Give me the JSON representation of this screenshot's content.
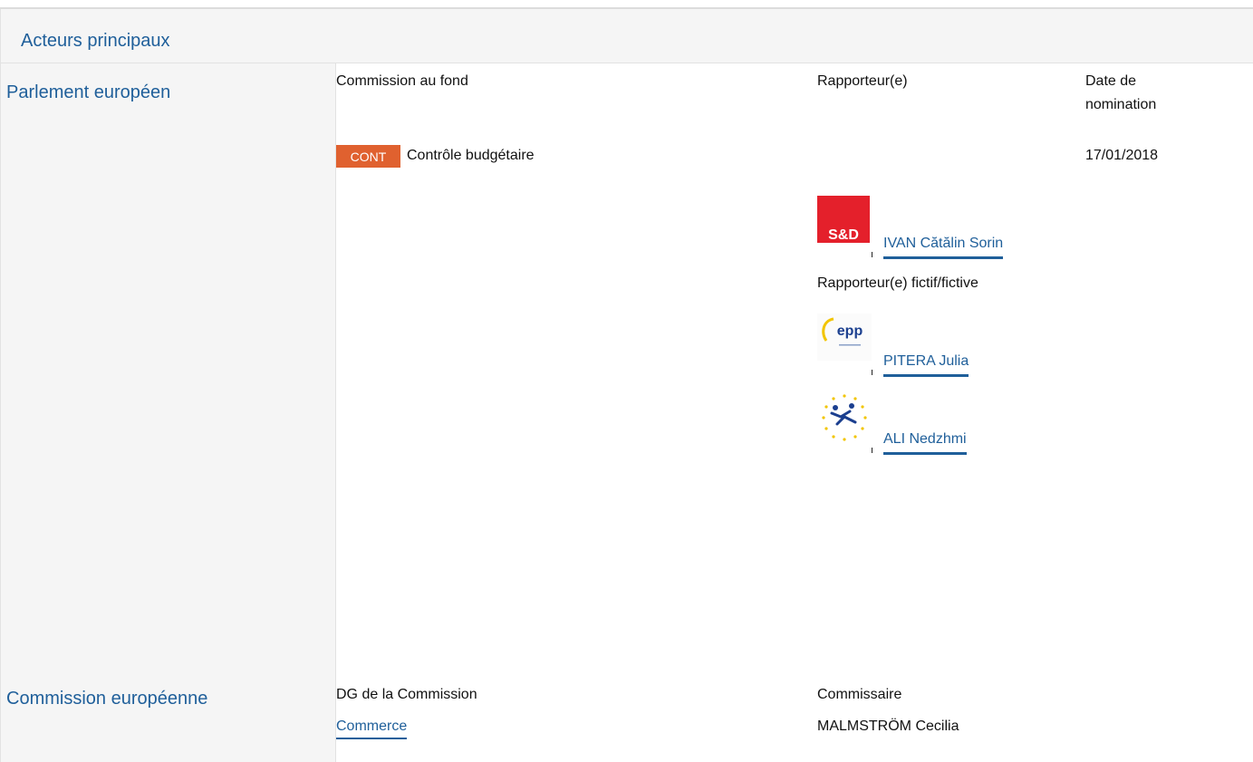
{
  "header": {
    "title": "Acteurs principaux"
  },
  "parlement": {
    "label": "Parlement européen",
    "col_committee": "Commission au fond",
    "col_rapporteur": "Rapporteur(e)",
    "col_date": "Date de nomination",
    "committee_badge": "CONT",
    "committee_name": "Contrôle budgétaire",
    "date": "17/01/2018",
    "rapporteur": {
      "logo": "S&D",
      "name": "IVAN Cătălin Sorin"
    },
    "shadow_label": "Rapporteur(e) fictif/fictive",
    "shadows": [
      {
        "logo": "epp",
        "name": "PITERA Julia"
      },
      {
        "logo": "ecr-alde-icon",
        "name": "ALI Nedzhmi"
      }
    ]
  },
  "commission": {
    "label": "Commission européenne",
    "col_dg": "DG de la Commission",
    "col_commissioner": "Commissaire",
    "dg": "Commerce",
    "commissioner": "MALMSTRÖM Cecilia"
  },
  "colors": {
    "accent": "#1f5f9a",
    "badge": "#e0612f",
    "sd_red": "#e4202b",
    "panel_bg": "#f5f5f5"
  }
}
